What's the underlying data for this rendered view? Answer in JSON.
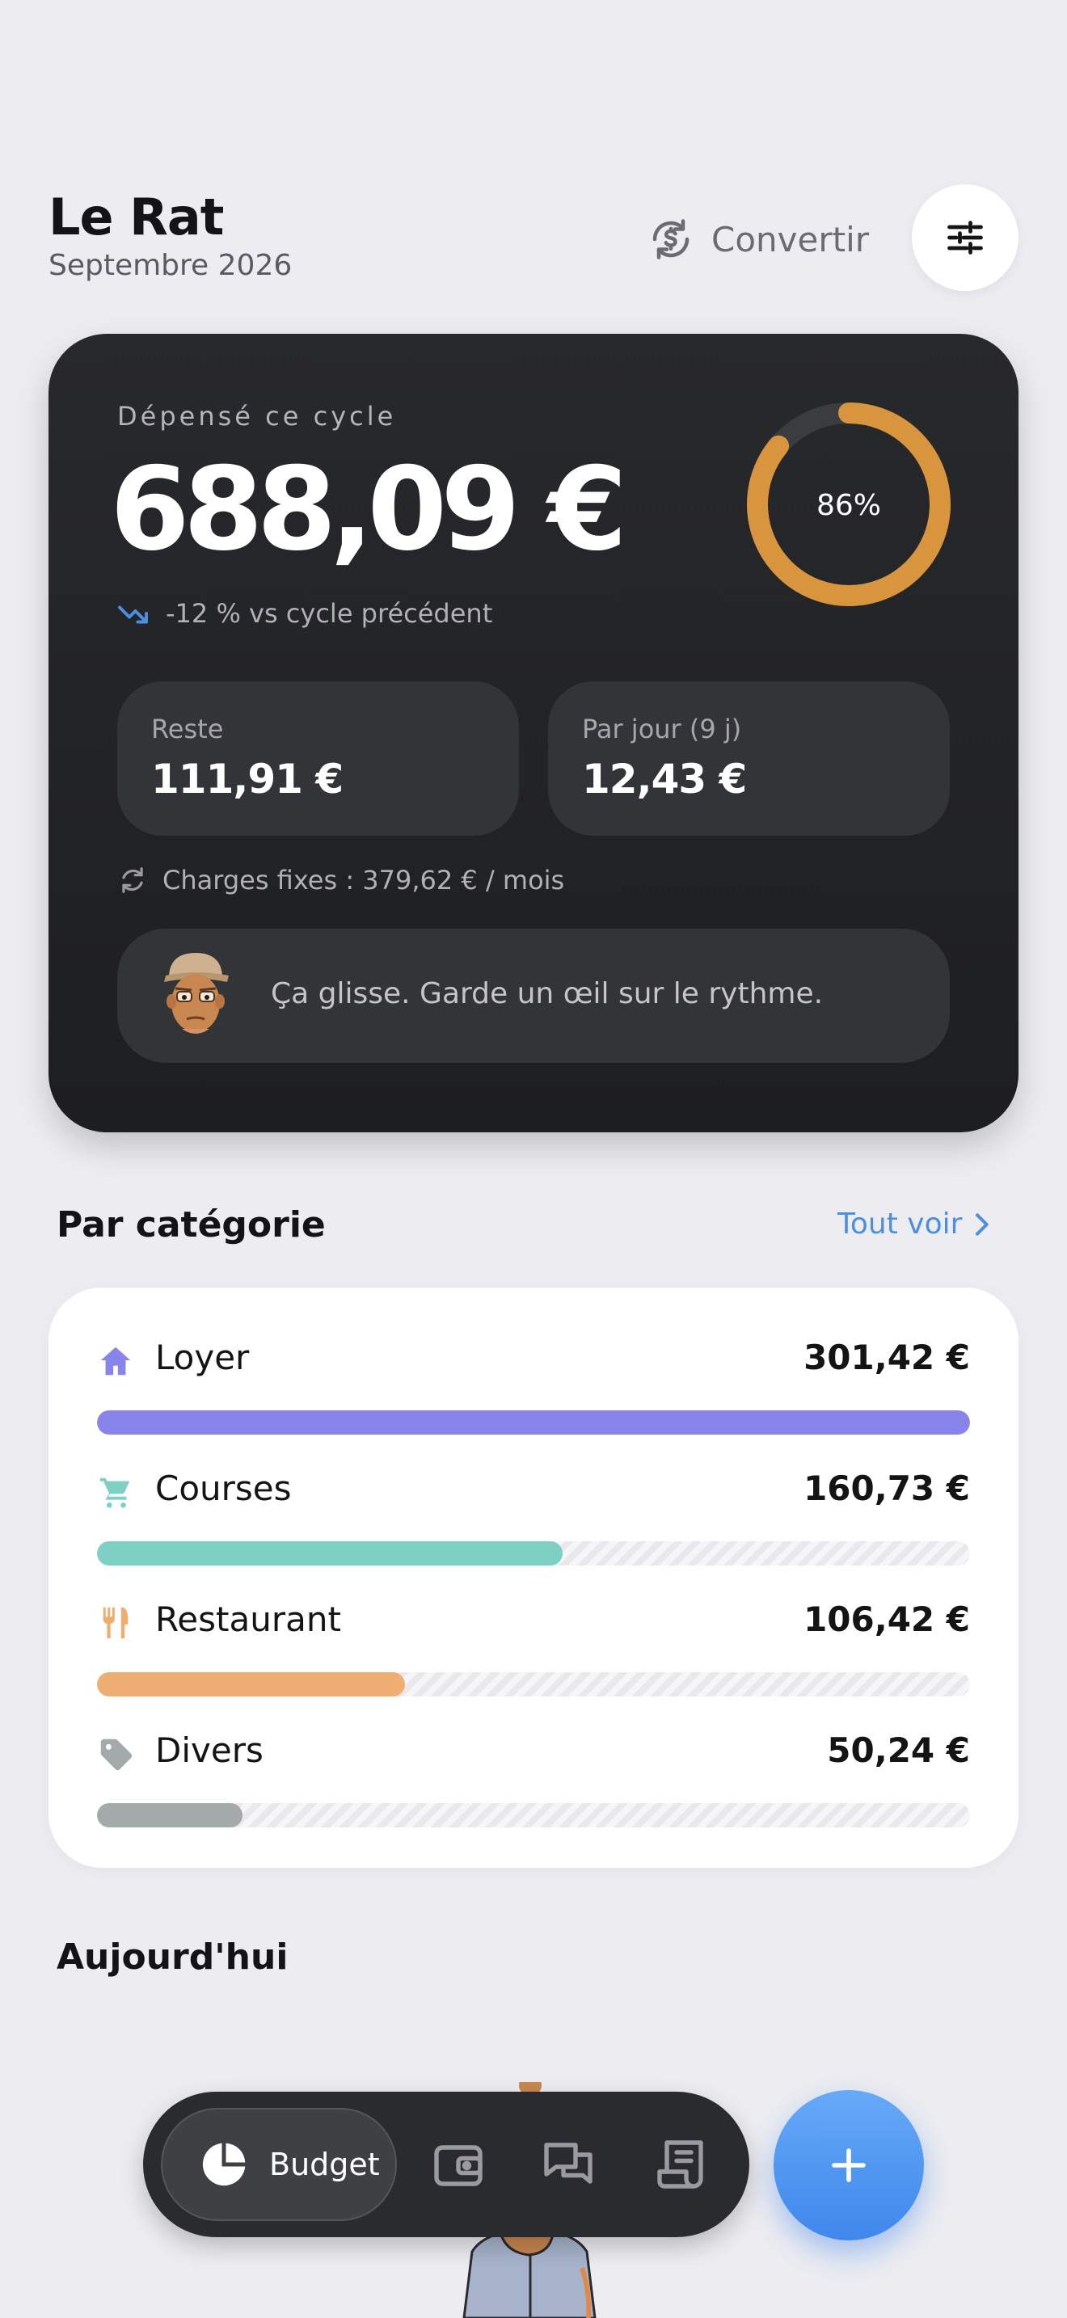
{
  "header": {
    "title": "Le Rat",
    "subtitle": "Septembre 2026",
    "convert_label": "Convertir",
    "convert_icon": "currency-exchange-icon",
    "filter_icon": "sliders-icon"
  },
  "summary": {
    "spent_label": "Dépensé ce cycle",
    "spent_amount": "688,09 €",
    "progress_percent": 86,
    "progress_label": "86%",
    "trend_text": "-12 % vs cycle précédent",
    "remaining_label": "Reste",
    "remaining_value": "111,91 €",
    "per_day_label": "Par jour (9 j)",
    "per_day_value": "12,43 €",
    "fixed_charges_text": "Charges fixes : 379,62 € / mois",
    "message": "Ça glisse. Garde un œil sur le rythme.",
    "colors": {
      "ring": "#d9953e",
      "trend": "#4c8fe0"
    }
  },
  "categories": {
    "title": "Par catégorie",
    "see_all_label": "Tout voir",
    "items": [
      {
        "name": "Loyer",
        "amount": "301,42 €",
        "fraction": 1.0,
        "color": "#8785ec",
        "icon": "home-icon"
      },
      {
        "name": "Courses",
        "amount": "160,73 €",
        "fraction": 0.533,
        "color": "#7ecfc4",
        "icon": "cart-icon"
      },
      {
        "name": "Restaurant",
        "amount": "106,42 €",
        "fraction": 0.353,
        "color": "#eeae72",
        "icon": "utensils-icon"
      },
      {
        "name": "Divers",
        "amount": "50,24 €",
        "fraction": 0.167,
        "color": "#a3aaa9",
        "icon": "tag-icon"
      }
    ]
  },
  "today": {
    "title": "Aujourd'hui"
  },
  "nav": {
    "budget_label": "Budget",
    "items": [
      "pie-chart-icon",
      "wallet-icon",
      "chat-icon",
      "receipt-icon"
    ],
    "fab_icon": "plus-icon"
  }
}
